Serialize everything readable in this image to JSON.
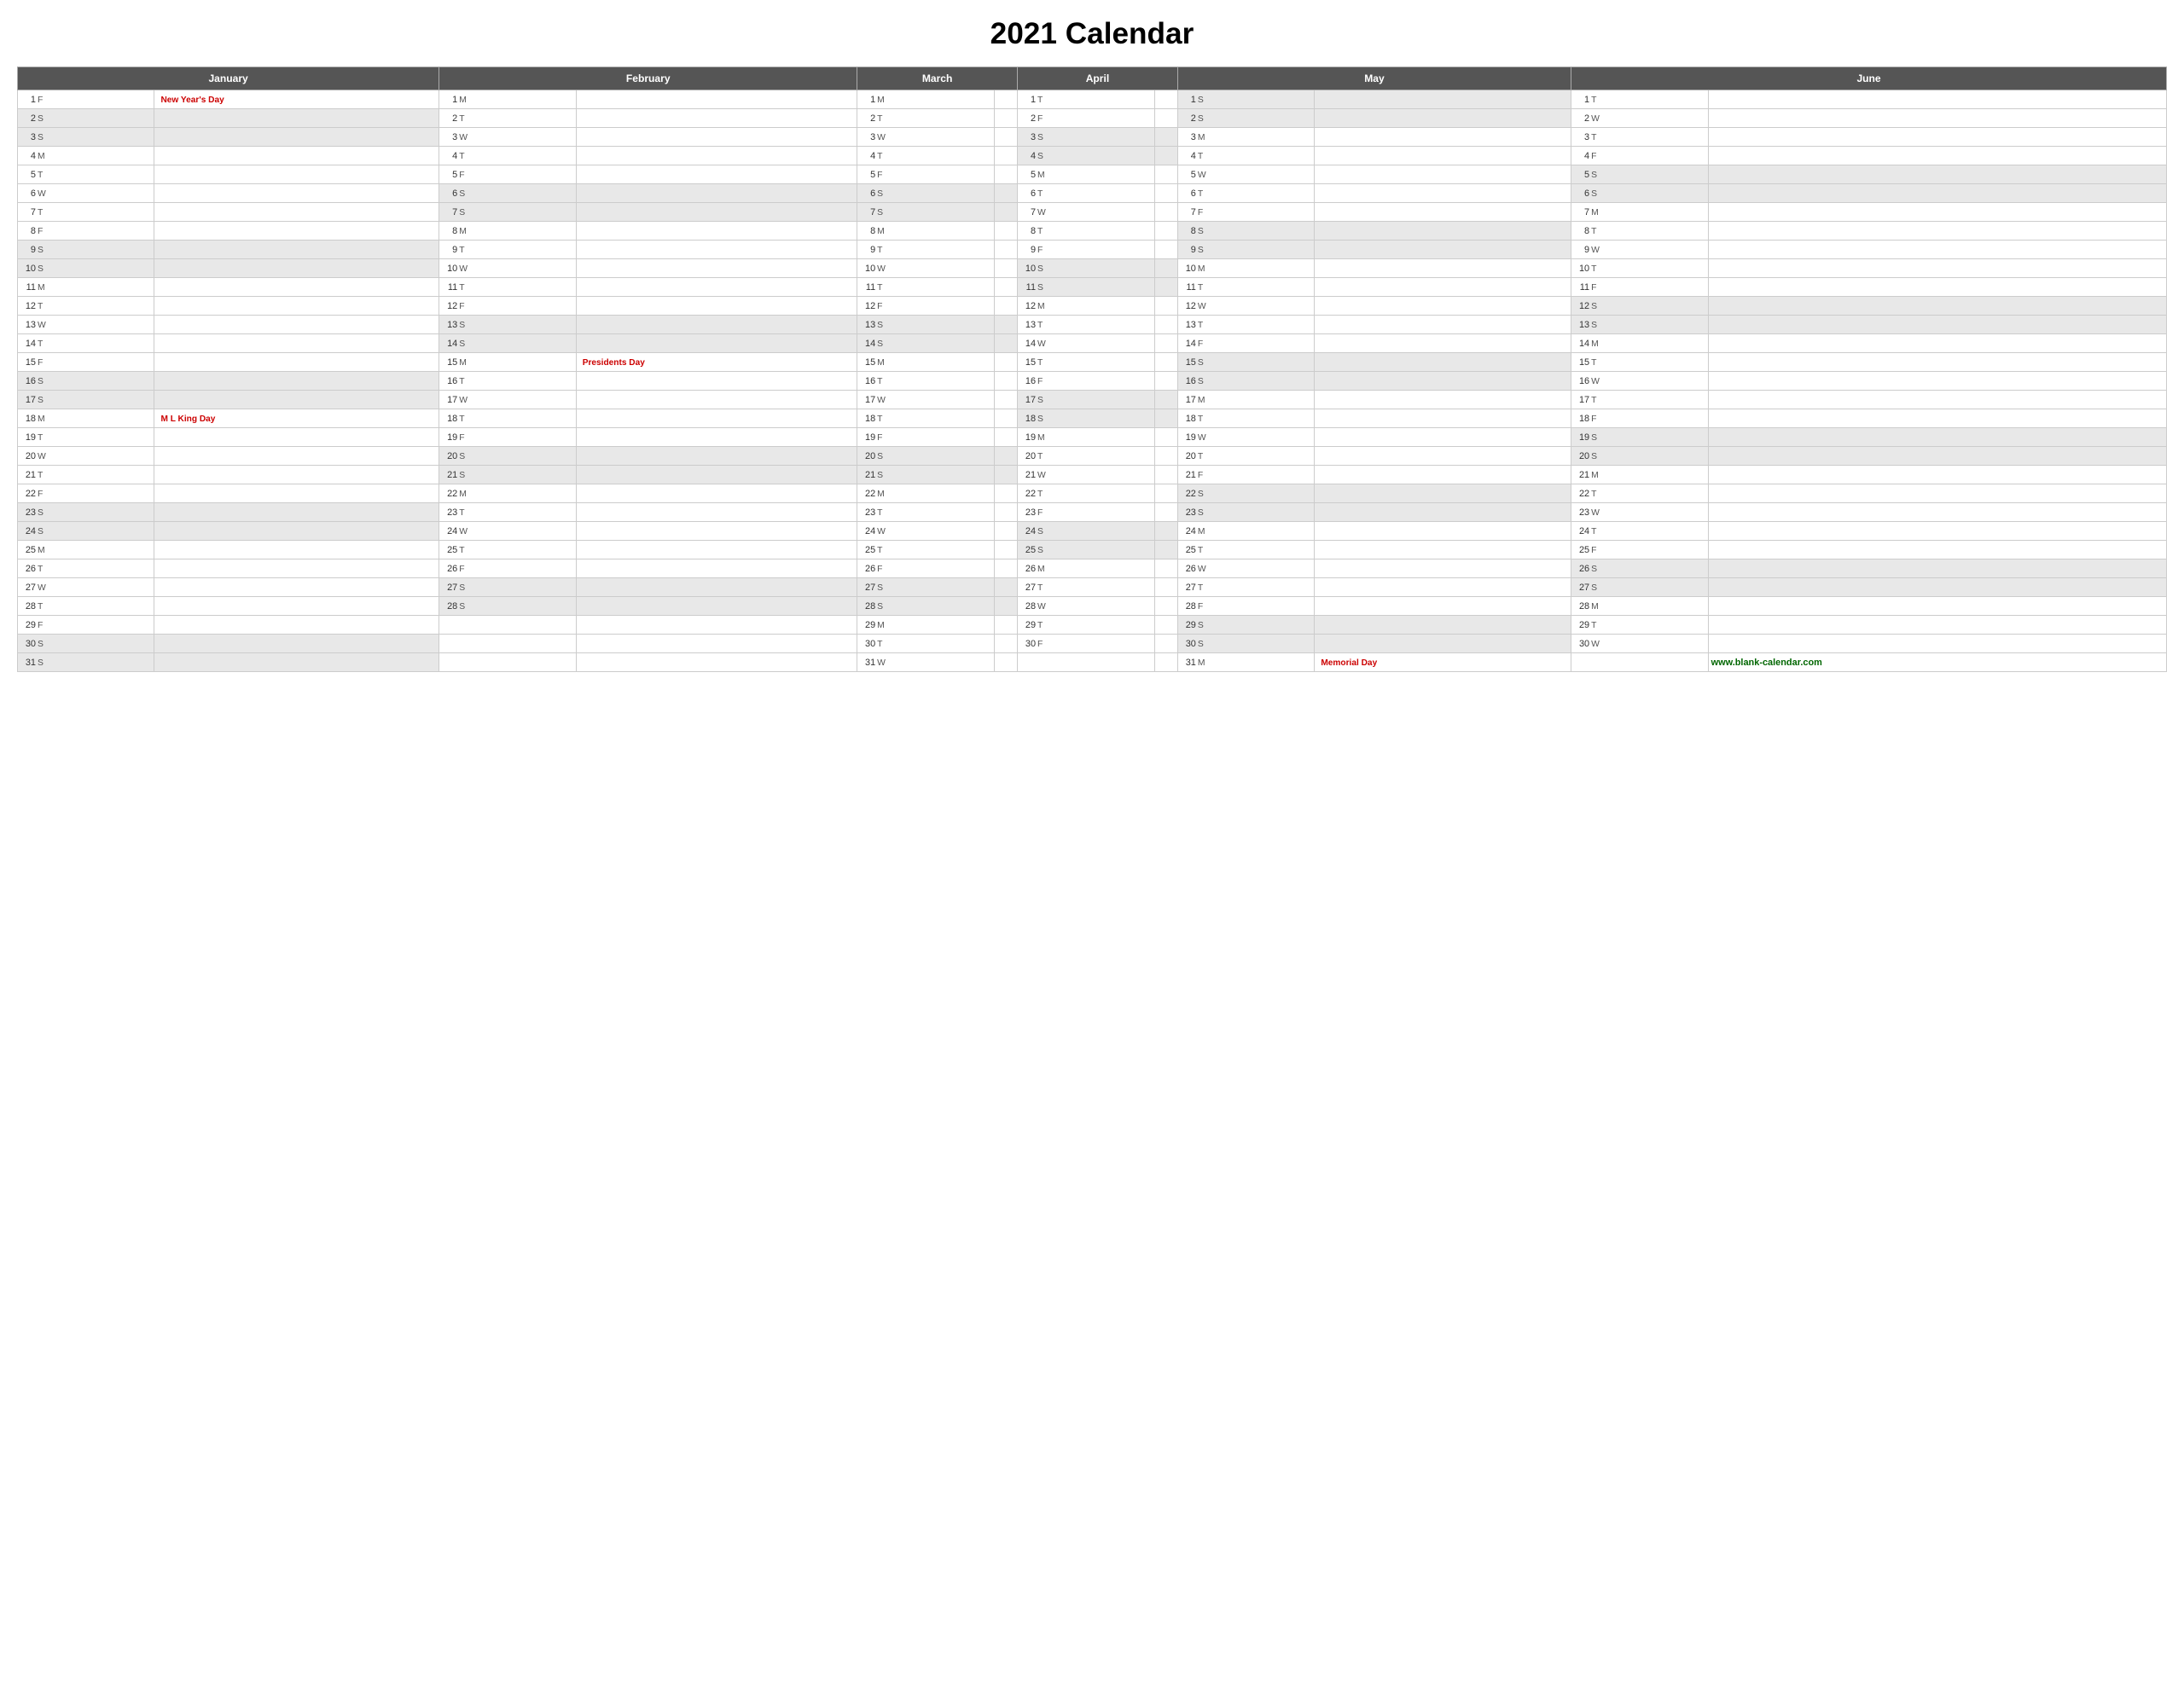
{
  "title": "2021 Calendar",
  "months": [
    "January",
    "February",
    "March",
    "April",
    "May",
    "June"
  ],
  "days": {
    "january": [
      {
        "d": 1,
        "w": "F",
        "holiday": "New Year's Day"
      },
      {
        "d": 2,
        "w": "S",
        "holiday": ""
      },
      {
        "d": 3,
        "w": "S",
        "holiday": ""
      },
      {
        "d": 4,
        "w": "M",
        "holiday": ""
      },
      {
        "d": 5,
        "w": "T",
        "holiday": ""
      },
      {
        "d": 6,
        "w": "W",
        "holiday": ""
      },
      {
        "d": 7,
        "w": "T",
        "holiday": ""
      },
      {
        "d": 8,
        "w": "F",
        "holiday": ""
      },
      {
        "d": 9,
        "w": "S",
        "holiday": ""
      },
      {
        "d": 10,
        "w": "S",
        "holiday": ""
      },
      {
        "d": 11,
        "w": "M",
        "holiday": ""
      },
      {
        "d": 12,
        "w": "T",
        "holiday": ""
      },
      {
        "d": 13,
        "w": "W",
        "holiday": ""
      },
      {
        "d": 14,
        "w": "T",
        "holiday": ""
      },
      {
        "d": 15,
        "w": "F",
        "holiday": ""
      },
      {
        "d": 16,
        "w": "S",
        "holiday": ""
      },
      {
        "d": 17,
        "w": "S",
        "holiday": ""
      },
      {
        "d": 18,
        "w": "M",
        "holiday": "M L King Day"
      },
      {
        "d": 19,
        "w": "T",
        "holiday": ""
      },
      {
        "d": 20,
        "w": "W",
        "holiday": ""
      },
      {
        "d": 21,
        "w": "T",
        "holiday": ""
      },
      {
        "d": 22,
        "w": "F",
        "holiday": ""
      },
      {
        "d": 23,
        "w": "S",
        "holiday": ""
      },
      {
        "d": 24,
        "w": "S",
        "holiday": ""
      },
      {
        "d": 25,
        "w": "M",
        "holiday": ""
      },
      {
        "d": 26,
        "w": "T",
        "holiday": ""
      },
      {
        "d": 27,
        "w": "W",
        "holiday": ""
      },
      {
        "d": 28,
        "w": "T",
        "holiday": ""
      },
      {
        "d": 29,
        "w": "F",
        "holiday": ""
      },
      {
        "d": 30,
        "w": "S",
        "holiday": ""
      },
      {
        "d": 31,
        "w": "S",
        "holiday": ""
      }
    ],
    "february": [
      {
        "d": 1,
        "w": "M",
        "holiday": ""
      },
      {
        "d": 2,
        "w": "T",
        "holiday": ""
      },
      {
        "d": 3,
        "w": "W",
        "holiday": ""
      },
      {
        "d": 4,
        "w": "T",
        "holiday": ""
      },
      {
        "d": 5,
        "w": "F",
        "holiday": ""
      },
      {
        "d": 6,
        "w": "S",
        "holiday": ""
      },
      {
        "d": 7,
        "w": "S",
        "holiday": ""
      },
      {
        "d": 8,
        "w": "M",
        "holiday": ""
      },
      {
        "d": 9,
        "w": "T",
        "holiday": ""
      },
      {
        "d": 10,
        "w": "W",
        "holiday": ""
      },
      {
        "d": 11,
        "w": "T",
        "holiday": ""
      },
      {
        "d": 12,
        "w": "F",
        "holiday": ""
      },
      {
        "d": 13,
        "w": "S",
        "holiday": ""
      },
      {
        "d": 14,
        "w": "S",
        "holiday": ""
      },
      {
        "d": 15,
        "w": "M",
        "holiday": "Presidents Day"
      },
      {
        "d": 16,
        "w": "T",
        "holiday": ""
      },
      {
        "d": 17,
        "w": "W",
        "holiday": ""
      },
      {
        "d": 18,
        "w": "T",
        "holiday": ""
      },
      {
        "d": 19,
        "w": "F",
        "holiday": ""
      },
      {
        "d": 20,
        "w": "S",
        "holiday": ""
      },
      {
        "d": 21,
        "w": "S",
        "holiday": ""
      },
      {
        "d": 22,
        "w": "M",
        "holiday": ""
      },
      {
        "d": 23,
        "w": "T",
        "holiday": ""
      },
      {
        "d": 24,
        "w": "W",
        "holiday": ""
      },
      {
        "d": 25,
        "w": "T",
        "holiday": ""
      },
      {
        "d": 26,
        "w": "F",
        "holiday": ""
      },
      {
        "d": 27,
        "w": "S",
        "holiday": ""
      },
      {
        "d": 28,
        "w": "S",
        "holiday": ""
      }
    ],
    "march": [
      {
        "d": 1,
        "w": "M",
        "holiday": ""
      },
      {
        "d": 2,
        "w": "T",
        "holiday": ""
      },
      {
        "d": 3,
        "w": "W",
        "holiday": ""
      },
      {
        "d": 4,
        "w": "T",
        "holiday": ""
      },
      {
        "d": 5,
        "w": "F",
        "holiday": ""
      },
      {
        "d": 6,
        "w": "S",
        "holiday": ""
      },
      {
        "d": 7,
        "w": "S",
        "holiday": ""
      },
      {
        "d": 8,
        "w": "M",
        "holiday": ""
      },
      {
        "d": 9,
        "w": "T",
        "holiday": ""
      },
      {
        "d": 10,
        "w": "W",
        "holiday": ""
      },
      {
        "d": 11,
        "w": "T",
        "holiday": ""
      },
      {
        "d": 12,
        "w": "F",
        "holiday": ""
      },
      {
        "d": 13,
        "w": "S",
        "holiday": ""
      },
      {
        "d": 14,
        "w": "S",
        "holiday": ""
      },
      {
        "d": 15,
        "w": "M",
        "holiday": ""
      },
      {
        "d": 16,
        "w": "T",
        "holiday": ""
      },
      {
        "d": 17,
        "w": "W",
        "holiday": ""
      },
      {
        "d": 18,
        "w": "T",
        "holiday": ""
      },
      {
        "d": 19,
        "w": "F",
        "holiday": ""
      },
      {
        "d": 20,
        "w": "S",
        "holiday": ""
      },
      {
        "d": 21,
        "w": "S",
        "holiday": ""
      },
      {
        "d": 22,
        "w": "M",
        "holiday": ""
      },
      {
        "d": 23,
        "w": "T",
        "holiday": ""
      },
      {
        "d": 24,
        "w": "W",
        "holiday": ""
      },
      {
        "d": 25,
        "w": "T",
        "holiday": ""
      },
      {
        "d": 26,
        "w": "F",
        "holiday": ""
      },
      {
        "d": 27,
        "w": "S",
        "holiday": ""
      },
      {
        "d": 28,
        "w": "S",
        "holiday": ""
      },
      {
        "d": 29,
        "w": "M",
        "holiday": ""
      },
      {
        "d": 30,
        "w": "T",
        "holiday": ""
      },
      {
        "d": 31,
        "w": "W",
        "holiday": ""
      }
    ],
    "april": [
      {
        "d": 1,
        "w": "T",
        "holiday": ""
      },
      {
        "d": 2,
        "w": "F",
        "holiday": ""
      },
      {
        "d": 3,
        "w": "S",
        "holiday": ""
      },
      {
        "d": 4,
        "w": "S",
        "holiday": ""
      },
      {
        "d": 5,
        "w": "M",
        "holiday": ""
      },
      {
        "d": 6,
        "w": "T",
        "holiday": ""
      },
      {
        "d": 7,
        "w": "W",
        "holiday": ""
      },
      {
        "d": 8,
        "w": "T",
        "holiday": ""
      },
      {
        "d": 9,
        "w": "F",
        "holiday": ""
      },
      {
        "d": 10,
        "w": "S",
        "holiday": ""
      },
      {
        "d": 11,
        "w": "S",
        "holiday": ""
      },
      {
        "d": 12,
        "w": "M",
        "holiday": ""
      },
      {
        "d": 13,
        "w": "T",
        "holiday": ""
      },
      {
        "d": 14,
        "w": "W",
        "holiday": ""
      },
      {
        "d": 15,
        "w": "T",
        "holiday": ""
      },
      {
        "d": 16,
        "w": "F",
        "holiday": ""
      },
      {
        "d": 17,
        "w": "S",
        "holiday": ""
      },
      {
        "d": 18,
        "w": "S",
        "holiday": ""
      },
      {
        "d": 19,
        "w": "M",
        "holiday": ""
      },
      {
        "d": 20,
        "w": "T",
        "holiday": ""
      },
      {
        "d": 21,
        "w": "W",
        "holiday": ""
      },
      {
        "d": 22,
        "w": "T",
        "holiday": ""
      },
      {
        "d": 23,
        "w": "F",
        "holiday": ""
      },
      {
        "d": 24,
        "w": "S",
        "holiday": ""
      },
      {
        "d": 25,
        "w": "S",
        "holiday": ""
      },
      {
        "d": 26,
        "w": "M",
        "holiday": ""
      },
      {
        "d": 27,
        "w": "T",
        "holiday": ""
      },
      {
        "d": 28,
        "w": "W",
        "holiday": ""
      },
      {
        "d": 29,
        "w": "T",
        "holiday": ""
      },
      {
        "d": 30,
        "w": "F",
        "holiday": ""
      }
    ],
    "may": [
      {
        "d": 1,
        "w": "S",
        "holiday": ""
      },
      {
        "d": 2,
        "w": "S",
        "holiday": ""
      },
      {
        "d": 3,
        "w": "M",
        "holiday": ""
      },
      {
        "d": 4,
        "w": "T",
        "holiday": ""
      },
      {
        "d": 5,
        "w": "W",
        "holiday": ""
      },
      {
        "d": 6,
        "w": "T",
        "holiday": ""
      },
      {
        "d": 7,
        "w": "F",
        "holiday": ""
      },
      {
        "d": 8,
        "w": "S",
        "holiday": ""
      },
      {
        "d": 9,
        "w": "S",
        "holiday": ""
      },
      {
        "d": 10,
        "w": "M",
        "holiday": ""
      },
      {
        "d": 11,
        "w": "T",
        "holiday": ""
      },
      {
        "d": 12,
        "w": "W",
        "holiday": ""
      },
      {
        "d": 13,
        "w": "T",
        "holiday": ""
      },
      {
        "d": 14,
        "w": "F",
        "holiday": ""
      },
      {
        "d": 15,
        "w": "S",
        "holiday": ""
      },
      {
        "d": 16,
        "w": "S",
        "holiday": ""
      },
      {
        "d": 17,
        "w": "M",
        "holiday": ""
      },
      {
        "d": 18,
        "w": "T",
        "holiday": ""
      },
      {
        "d": 19,
        "w": "W",
        "holiday": ""
      },
      {
        "d": 20,
        "w": "T",
        "holiday": ""
      },
      {
        "d": 21,
        "w": "F",
        "holiday": ""
      },
      {
        "d": 22,
        "w": "S",
        "holiday": ""
      },
      {
        "d": 23,
        "w": "S",
        "holiday": ""
      },
      {
        "d": 24,
        "w": "M",
        "holiday": ""
      },
      {
        "d": 25,
        "w": "T",
        "holiday": ""
      },
      {
        "d": 26,
        "w": "W",
        "holiday": ""
      },
      {
        "d": 27,
        "w": "T",
        "holiday": ""
      },
      {
        "d": 28,
        "w": "F",
        "holiday": ""
      },
      {
        "d": 29,
        "w": "S",
        "holiday": ""
      },
      {
        "d": 30,
        "w": "S",
        "holiday": ""
      },
      {
        "d": 31,
        "w": "M",
        "holiday": "Memorial Day"
      }
    ],
    "june": [
      {
        "d": 1,
        "w": "T",
        "holiday": ""
      },
      {
        "d": 2,
        "w": "W",
        "holiday": ""
      },
      {
        "d": 3,
        "w": "T",
        "holiday": ""
      },
      {
        "d": 4,
        "w": "F",
        "holiday": ""
      },
      {
        "d": 5,
        "w": "S",
        "holiday": ""
      },
      {
        "d": 6,
        "w": "S",
        "holiday": ""
      },
      {
        "d": 7,
        "w": "M",
        "holiday": ""
      },
      {
        "d": 8,
        "w": "T",
        "holiday": ""
      },
      {
        "d": 9,
        "w": "W",
        "holiday": ""
      },
      {
        "d": 10,
        "w": "T",
        "holiday": ""
      },
      {
        "d": 11,
        "w": "F",
        "holiday": ""
      },
      {
        "d": 12,
        "w": "S",
        "holiday": ""
      },
      {
        "d": 13,
        "w": "S",
        "holiday": ""
      },
      {
        "d": 14,
        "w": "M",
        "holiday": ""
      },
      {
        "d": 15,
        "w": "T",
        "holiday": ""
      },
      {
        "d": 16,
        "w": "W",
        "holiday": ""
      },
      {
        "d": 17,
        "w": "T",
        "holiday": ""
      },
      {
        "d": 18,
        "w": "F",
        "holiday": ""
      },
      {
        "d": 19,
        "w": "S",
        "holiday": ""
      },
      {
        "d": 20,
        "w": "S",
        "holiday": ""
      },
      {
        "d": 21,
        "w": "M",
        "holiday": ""
      },
      {
        "d": 22,
        "w": "T",
        "holiday": ""
      },
      {
        "d": 23,
        "w": "W",
        "holiday": ""
      },
      {
        "d": 24,
        "w": "T",
        "holiday": ""
      },
      {
        "d": 25,
        "w": "F",
        "holiday": ""
      },
      {
        "d": 26,
        "w": "S",
        "holiday": ""
      },
      {
        "d": 27,
        "w": "S",
        "holiday": ""
      },
      {
        "d": 28,
        "w": "M",
        "holiday": ""
      },
      {
        "d": 29,
        "w": "T",
        "holiday": ""
      },
      {
        "d": 30,
        "w": "W",
        "holiday": ""
      }
    ]
  },
  "footer": {
    "website": "www.blank-calendar.com"
  }
}
